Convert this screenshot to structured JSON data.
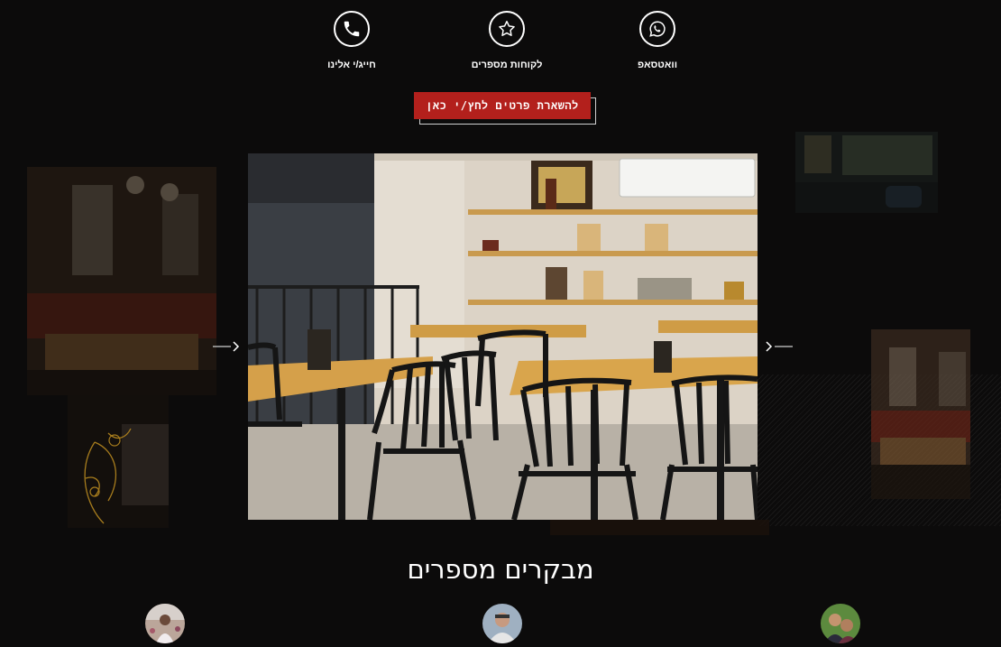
{
  "contacts": {
    "phone": {
      "label": "חייג/י אלינו",
      "icon": "phone-icon"
    },
    "reviews": {
      "label": "לקוחות מספרים",
      "icon": "star-icon"
    },
    "whatsapp": {
      "label": "וואטסאפ",
      "icon": "whatsapp-icon"
    }
  },
  "cta": {
    "label": "להשארת פרטים לחץ/י כאן"
  },
  "gallery": {
    "prev_icon": "chevron-left-icon",
    "next_icon": "chevron-right-icon"
  },
  "reviews": {
    "title": "מבקרים מספרים"
  },
  "colors": {
    "background": "#0c0b0b",
    "accent": "#b3201c",
    "text": "#ffffff"
  }
}
